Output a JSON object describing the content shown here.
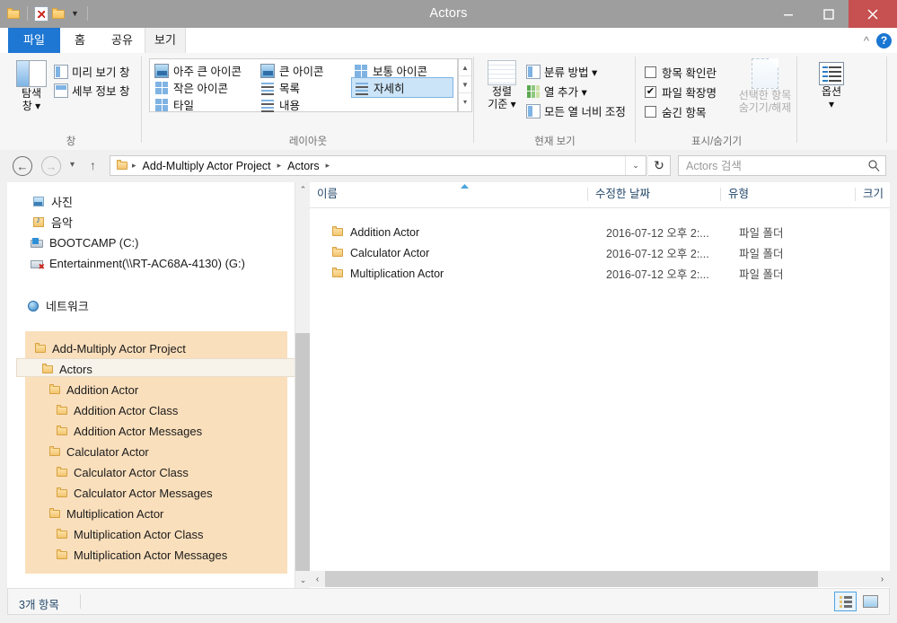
{
  "window": {
    "title": "Actors",
    "minimize_label": "minimize",
    "maximize_label": "maximize",
    "close_label": "close"
  },
  "quick_access": {
    "folder_icon": "folder-icon",
    "properties_icon": "properties-icon",
    "new_folder_icon": "new-folder-icon",
    "customize_caret": "▼"
  },
  "tabs": [
    {
      "label": "파일",
      "id": "file"
    },
    {
      "label": "홈",
      "id": "home"
    },
    {
      "label": "공유",
      "id": "share"
    },
    {
      "label": "보기",
      "id": "view"
    }
  ],
  "help": {
    "collapse_icon": "^",
    "help_label": "?"
  },
  "ribbon": {
    "groups": [
      {
        "id": "pane",
        "label": "창"
      },
      {
        "id": "layout",
        "label": "레이아웃"
      },
      {
        "id": "current_view",
        "label": "현재 보기"
      },
      {
        "id": "show_hide",
        "label": "표시/숨기기"
      },
      {
        "id": "options",
        "label": ""
      }
    ],
    "pane_group": {
      "nav_pane_line1": "탐색",
      "nav_pane_line2": "창 ▾",
      "preview_pane": "미리 보기 창",
      "details_pane": "세부 정보 창"
    },
    "layout_group": {
      "items": [
        "아주 큰 아이콘",
        "큰 아이콘",
        "보통 아이콘",
        "작은 아이콘",
        "목록",
        "자세히",
        "타일",
        "내용"
      ],
      "selected": "자세히",
      "scroll_up": "▲",
      "scroll_down": "▼",
      "scroll_more": "▾"
    },
    "current_view_group": {
      "sort_by_line1": "정렬",
      "sort_by_line2": "기준 ▾",
      "group_by": "분류 방법 ▾",
      "add_column": "열 추가 ▾",
      "size_all_columns": "모든 열 너비 조정"
    },
    "show_hide_group": {
      "item_checkboxes": "항목 확인란",
      "item_checkboxes_checked": false,
      "file_extensions": "파일 확장명",
      "file_extensions_checked": true,
      "hidden_items": "숨긴 항목",
      "hidden_items_checked": false,
      "hide_selected_line1": "선택한 항목",
      "hide_selected_line2": "숨기기/해제"
    },
    "options_group": {
      "label_line1": "옵션",
      "label_line2": "▾"
    }
  },
  "address_bar": {
    "back_icon": "←",
    "forward_icon": "→",
    "recent_icon": "▾",
    "up_icon": "↑",
    "breadcrumbs": [
      "Add-Multiply Actor Project",
      "Actors"
    ],
    "separator": "▸",
    "dropdown_icon": "⌄",
    "refresh_icon": "↻"
  },
  "search": {
    "placeholder": "Actors 검색",
    "value": "",
    "icon": "search-icon"
  },
  "nav_pane": {
    "items": [
      {
        "label": "사진",
        "icon": "pictures-icon",
        "indent": 0,
        "type": "library"
      },
      {
        "label": "음악",
        "icon": "music-icon",
        "indent": 0,
        "type": "library"
      },
      {
        "label": "BOOTCAMP (C:)",
        "icon": "drive-icon",
        "indent": 0,
        "type": "drive"
      },
      {
        "label": "Entertainment(\\\\RT-AC68A-4130) (G:)",
        "icon": "network-drive-icon",
        "indent": 0,
        "type": "drive"
      },
      {
        "label": "네트워크",
        "icon": "network-icon",
        "indent": 0,
        "type": "network"
      },
      {
        "label": "Add-Multiply Actor Project",
        "icon": "folder-icon",
        "indent": 0,
        "type": "folder"
      },
      {
        "label": "Actors",
        "icon": "folder-icon",
        "indent": 1,
        "type": "folder",
        "selected": true
      },
      {
        "label": "Addition Actor",
        "icon": "folder-icon",
        "indent": 2,
        "type": "folder"
      },
      {
        "label": "Addition Actor Class",
        "icon": "folder-icon",
        "indent": 3,
        "type": "folder"
      },
      {
        "label": "Addition Actor Messages",
        "icon": "folder-icon",
        "indent": 3,
        "type": "folder"
      },
      {
        "label": "Calculator Actor",
        "icon": "folder-icon",
        "indent": 2,
        "type": "folder"
      },
      {
        "label": "Calculator Actor Class",
        "icon": "folder-icon",
        "indent": 3,
        "type": "folder"
      },
      {
        "label": "Calculator Actor Messages",
        "icon": "folder-icon",
        "indent": 3,
        "type": "folder"
      },
      {
        "label": "Multiplication Actor",
        "icon": "folder-icon",
        "indent": 2,
        "type": "folder"
      },
      {
        "label": "Multiplication Actor Class",
        "icon": "folder-icon",
        "indent": 3,
        "type": "folder"
      },
      {
        "label": "Multiplication Actor Messages",
        "icon": "folder-icon",
        "indent": 3,
        "type": "folder"
      }
    ],
    "scroll_up": "⌃",
    "scroll_down": "⌄"
  },
  "file_list": {
    "columns": [
      {
        "label": "이름",
        "key": "name"
      },
      {
        "label": "수정한 날짜",
        "key": "date"
      },
      {
        "label": "유형",
        "key": "type"
      },
      {
        "label": "크기",
        "key": "size"
      }
    ],
    "sort_column": "이름",
    "sort_direction": "asc",
    "rows": [
      {
        "name": "Addition Actor",
        "date": "2016-07-12 오후 2:...",
        "type": "파일 폴더",
        "size": ""
      },
      {
        "name": "Calculator Actor",
        "date": "2016-07-12 오후 2:...",
        "type": "파일 폴더",
        "size": ""
      },
      {
        "name": "Multiplication Actor",
        "date": "2016-07-12 오후 2:...",
        "type": "파일 폴더",
        "size": ""
      }
    ],
    "h_scroll_left": "‹",
    "h_scroll_right": "›"
  },
  "status_bar": {
    "item_count": "3개 항목",
    "details_view_label": "details-view",
    "thumbnail_view_label": "large-icons-view"
  },
  "colors": {
    "accent_blue": "#1e77d3",
    "titlebar": "#9e9e9e",
    "close_red": "#c75050",
    "tree_highlight": "#fadfbc",
    "header_text": "#25496b"
  }
}
